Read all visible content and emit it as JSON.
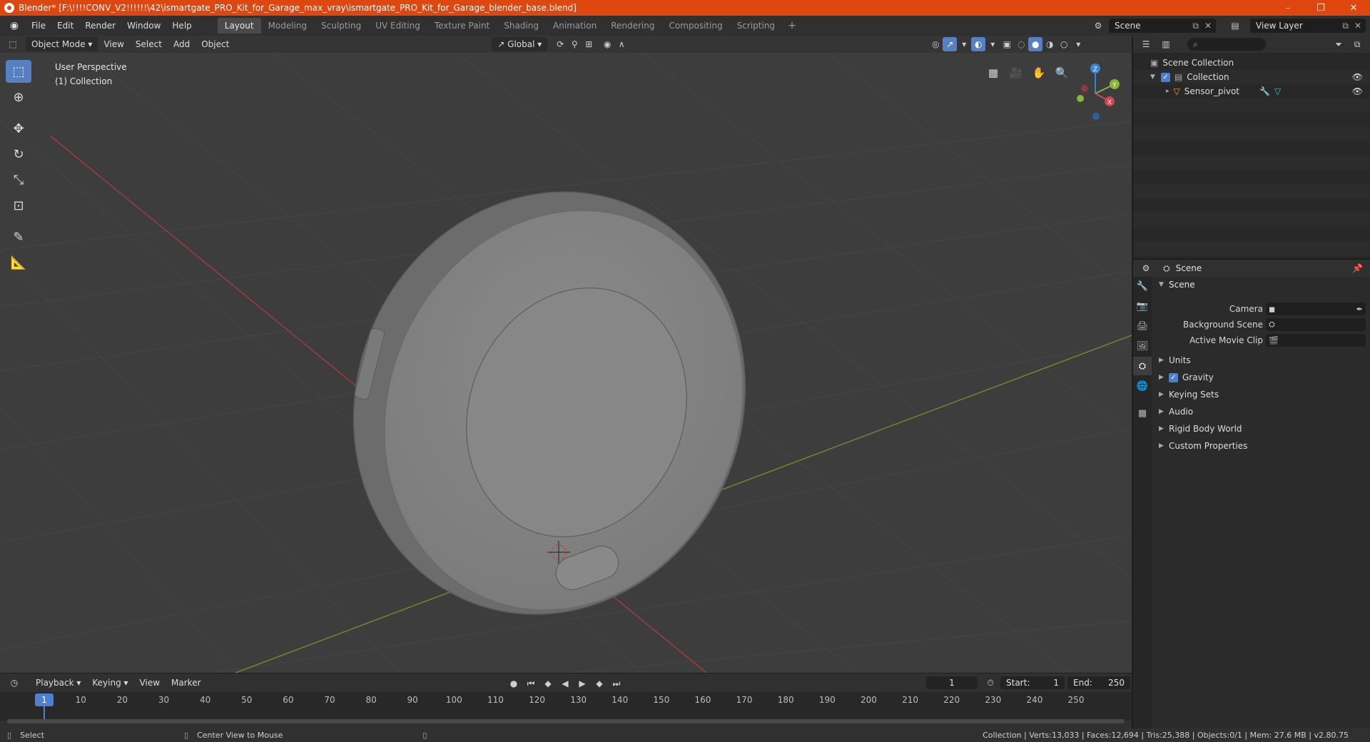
{
  "window": {
    "title": "Blender* [F:\\!!!!CONV_V2!!!!!!\\42\\ismartgate_PRO_Kit_for_Garage_max_vray\\ismartgate_PRO_Kit_for_Garage_blender_base.blend]",
    "minimize": "–",
    "restore": "❐",
    "close": "✕"
  },
  "menu": {
    "items": [
      "File",
      "Edit",
      "Render",
      "Window",
      "Help"
    ]
  },
  "workspaces": {
    "tabs": [
      "Layout",
      "Modeling",
      "Sculpting",
      "UV Editing",
      "Texture Paint",
      "Shading",
      "Animation",
      "Rendering",
      "Compositing",
      "Scripting"
    ],
    "active": "Layout",
    "add": "+"
  },
  "scene_selector": {
    "value": "Scene"
  },
  "view_layer_selector": {
    "value": "View Layer"
  },
  "viewport": {
    "mode": "Object Mode",
    "menus": [
      "View",
      "Select",
      "Add",
      "Object"
    ],
    "orientation": "Global",
    "perspective_label": "User Perspective",
    "collection_label": "(1) Collection",
    "gizmo": {
      "x": "X",
      "y": "Y",
      "z": "Z"
    }
  },
  "timeline": {
    "menus": [
      "Playback",
      "Keying",
      "View",
      "Marker"
    ],
    "current_frame": "1",
    "start_label": "Start:",
    "start": "1",
    "end_label": "End:",
    "end": "250",
    "ticks": [
      "1",
      "10",
      "20",
      "30",
      "40",
      "50",
      "60",
      "70",
      "80",
      "90",
      "100",
      "110",
      "120",
      "130",
      "140",
      "150",
      "160",
      "170",
      "180",
      "190",
      "200",
      "210",
      "220",
      "230",
      "240",
      "250"
    ],
    "playhead": "1"
  },
  "statusbar": {
    "left_action": "Select",
    "middle_action": "Center View to Mouse",
    "stats": "Collection | Verts:13,033 | Faces:12,694 | Tris:25,388 | Objects:0/1 | Mem: 27.6 MB | v2.80.75"
  },
  "outliner": {
    "search_placeholder": "",
    "rows": [
      {
        "label": "Scene Collection"
      },
      {
        "label": "Collection"
      },
      {
        "label": "Sensor_pivot"
      }
    ]
  },
  "properties": {
    "context": "Scene",
    "panel_title": "Scene",
    "fields": [
      {
        "label": "Camera"
      },
      {
        "label": "Background Scene"
      },
      {
        "label": "Active Movie Clip"
      }
    ],
    "subpanels": [
      "Units",
      "Gravity",
      "Keying Sets",
      "Audio",
      "Rigid Body World",
      "Custom Properties"
    ]
  },
  "colors": {
    "title_bar": "#e0460f",
    "accent": "#5680c2",
    "x_axis": "#d0454f",
    "y_axis": "#8ab43a",
    "z_axis": "#3b83d6"
  }
}
